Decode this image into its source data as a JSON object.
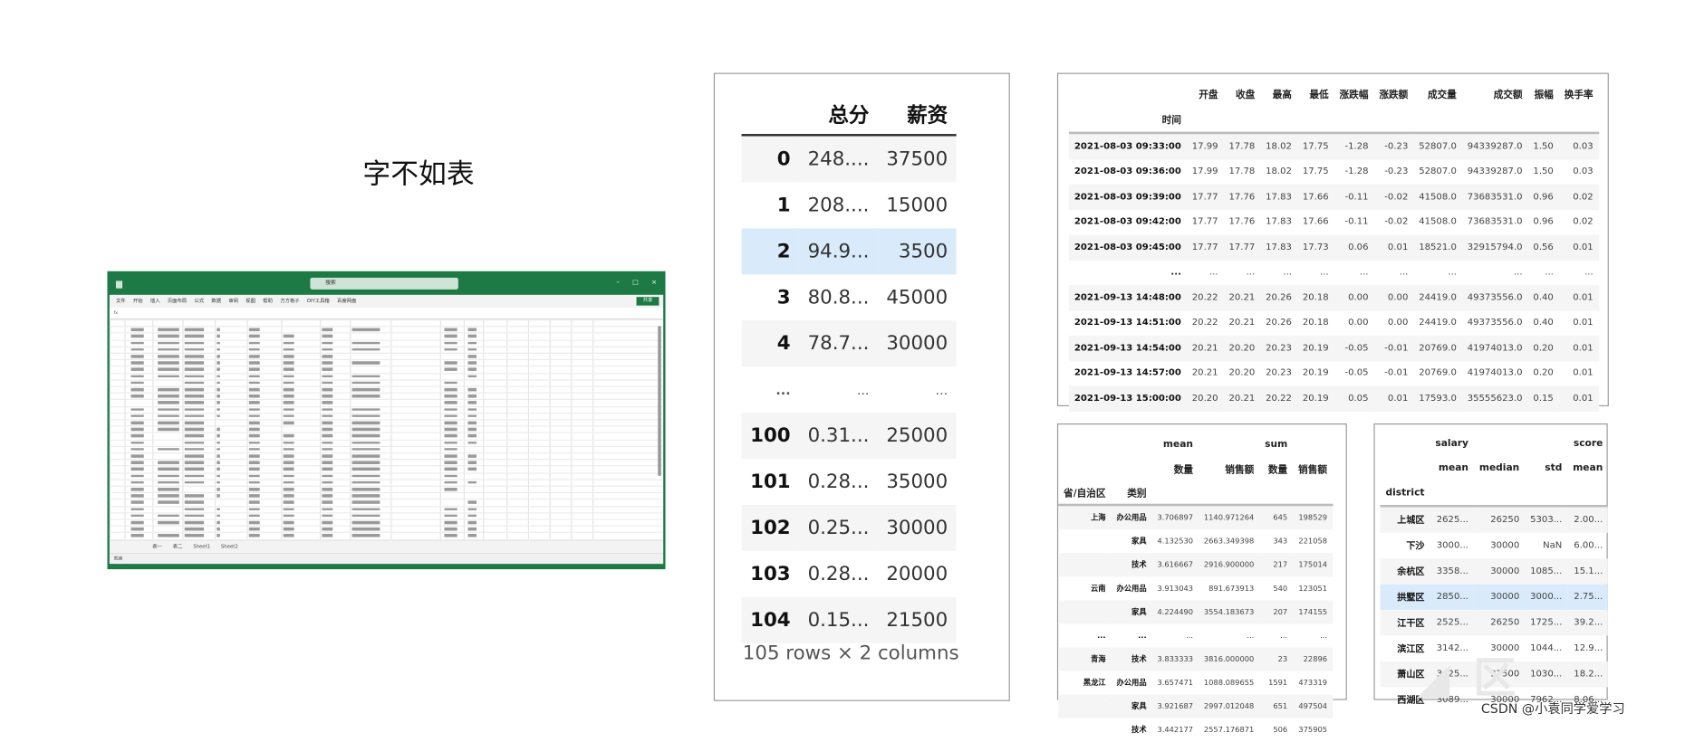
{
  "slide_title": "字不如表",
  "watermark": "CSDN @小袁同学爱学习",
  "excel": {
    "search_placeholder": "搜索",
    "menu": [
      "文件",
      "开始",
      "插入",
      "页面布局",
      "公式",
      "数据",
      "审阅",
      "视图",
      "帮助",
      "方方格子",
      "DIY工具箱",
      "百度网盘"
    ],
    "share_label": "共享",
    "sheet_tabs": [
      "表一",
      "表二",
      "Sheet1",
      "Sheet2"
    ],
    "status": "就绪",
    "accent": "#1d7a45"
  },
  "table1": {
    "columns": [
      "总分",
      "薪资"
    ],
    "rows": [
      [
        "0",
        "248....",
        "37500"
      ],
      [
        "1",
        "208....",
        "15000"
      ],
      [
        "2",
        "94.9...",
        "3500"
      ],
      [
        "3",
        "80.8...",
        "45000"
      ],
      [
        "4",
        "78.7...",
        "30000"
      ],
      [
        "...",
        "...",
        "..."
      ],
      [
        "100",
        "0.31...",
        "25000"
      ],
      [
        "101",
        "0.28...",
        "35000"
      ],
      [
        "102",
        "0.25...",
        "30000"
      ],
      [
        "103",
        "0.28...",
        "20000"
      ],
      [
        "104",
        "0.15...",
        "21500"
      ]
    ],
    "highlight_row": 2,
    "footer": "105 rows × 2 columns"
  },
  "table2": {
    "index_name": "时间",
    "columns": [
      "开盘",
      "收盘",
      "最高",
      "最低",
      "涨跌幅",
      "涨跌额",
      "成交量",
      "成交额",
      "振幅",
      "换手率"
    ],
    "rows": [
      [
        "2021-08-03 09:33:00",
        "17.99",
        "17.78",
        "18.02",
        "17.75",
        "-1.28",
        "-0.23",
        "52807.0",
        "94339287.0",
        "1.50",
        "0.03"
      ],
      [
        "2021-08-03 09:36:00",
        "17.99",
        "17.78",
        "18.02",
        "17.75",
        "-1.28",
        "-0.23",
        "52807.0",
        "94339287.0",
        "1.50",
        "0.03"
      ],
      [
        "2021-08-03 09:39:00",
        "17.77",
        "17.76",
        "17.83",
        "17.66",
        "-0.11",
        "-0.02",
        "41508.0",
        "73683531.0",
        "0.96",
        "0.02"
      ],
      [
        "2021-08-03 09:42:00",
        "17.77",
        "17.76",
        "17.83",
        "17.66",
        "-0.11",
        "-0.02",
        "41508.0",
        "73683531.0",
        "0.96",
        "0.02"
      ],
      [
        "2021-08-03 09:45:00",
        "17.77",
        "17.77",
        "17.83",
        "17.73",
        "0.06",
        "0.01",
        "18521.0",
        "32915794.0",
        "0.56",
        "0.01"
      ],
      [
        "...",
        "...",
        "...",
        "...",
        "...",
        "...",
        "...",
        "...",
        "...",
        "...",
        "..."
      ],
      [
        "2021-09-13 14:48:00",
        "20.22",
        "20.21",
        "20.26",
        "20.18",
        "0.00",
        "0.00",
        "24419.0",
        "49373556.0",
        "0.40",
        "0.01"
      ],
      [
        "2021-09-13 14:51:00",
        "20.22",
        "20.21",
        "20.26",
        "20.18",
        "0.00",
        "0.00",
        "24419.0",
        "49373556.0",
        "0.40",
        "0.01"
      ],
      [
        "2021-09-13 14:54:00",
        "20.21",
        "20.20",
        "20.23",
        "20.19",
        "-0.05",
        "-0.01",
        "20769.0",
        "41974013.0",
        "0.20",
        "0.01"
      ],
      [
        "2021-09-13 14:57:00",
        "20.21",
        "20.20",
        "20.23",
        "20.19",
        "-0.05",
        "-0.01",
        "20769.0",
        "41974013.0",
        "0.20",
        "0.01"
      ],
      [
        "2021-09-13 15:00:00",
        "20.20",
        "20.21",
        "20.22",
        "20.19",
        "0.05",
        "0.01",
        "17593.0",
        "35555623.0",
        "0.15",
        "0.01"
      ]
    ]
  },
  "table3": {
    "top_columns": [
      "mean",
      "sum"
    ],
    "sub_columns": [
      "数量",
      "销售额",
      "数量",
      "销售额"
    ],
    "index_names": [
      "省/自治区",
      "类别"
    ],
    "rows": [
      [
        "上海",
        "办公用品",
        "3.706897",
        "1140.971264",
        "645",
        "198529"
      ],
      [
        "",
        "家具",
        "4.132530",
        "2663.349398",
        "343",
        "221058"
      ],
      [
        "",
        "技术",
        "3.616667",
        "2916.900000",
        "217",
        "175014"
      ],
      [
        "云南",
        "办公用品",
        "3.913043",
        "891.673913",
        "540",
        "123051"
      ],
      [
        "",
        "家具",
        "4.224490",
        "3554.183673",
        "207",
        "174155"
      ],
      [
        "...",
        "...",
        "...",
        "...",
        "...",
        "..."
      ],
      [
        "青海",
        "技术",
        "3.833333",
        "3816.000000",
        "23",
        "22896"
      ],
      [
        "黑龙江",
        "办公用品",
        "3.657471",
        "1088.089655",
        "1591",
        "473319"
      ],
      [
        "",
        "家具",
        "3.921687",
        "2997.012048",
        "651",
        "497504"
      ],
      [
        "",
        "技术",
        "3.442177",
        "2557.176871",
        "506",
        "375905"
      ]
    ]
  },
  "table4": {
    "top_columns": [
      "salary",
      "score"
    ],
    "sub_columns": [
      "mean",
      "median",
      "std",
      "mean"
    ],
    "index_name": "district",
    "rows": [
      [
        "上城区",
        "2625...",
        "26250",
        "5303...",
        "2.00..."
      ],
      [
        "下沙",
        "3000...",
        "30000",
        "NaN",
        "6.00..."
      ],
      [
        "余杭区",
        "3358...",
        "30000",
        "1085...",
        "15.1..."
      ],
      [
        "拱墅区",
        "2850...",
        "30000",
        "3000...",
        "2.75..."
      ],
      [
        "江干区",
        "2525...",
        "26250",
        "1725...",
        "39.2..."
      ],
      [
        "滨江区",
        "3142...",
        "30000",
        "1044...",
        "12.9..."
      ],
      [
        "萧山区",
        "3625...",
        "37500",
        "1030...",
        "18.2..."
      ],
      [
        "西湖区",
        "3089...",
        "30000",
        "7962...",
        "8.06..."
      ]
    ],
    "highlight_row": 3
  }
}
